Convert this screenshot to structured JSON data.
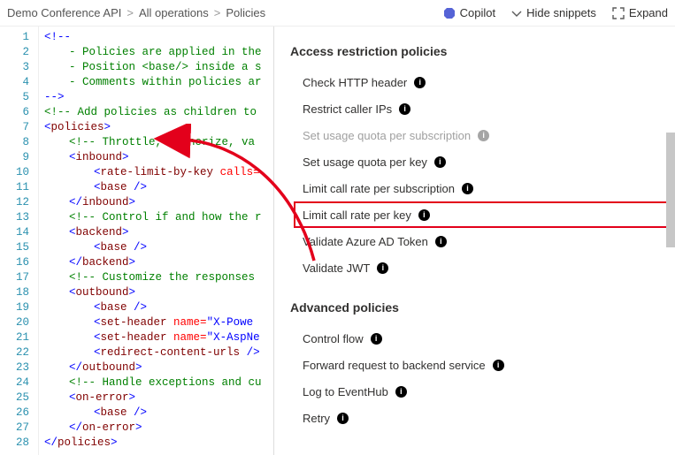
{
  "breadcrumb": {
    "api": "Demo Conference API",
    "scope": "All operations",
    "section": "Policies"
  },
  "toolbar": {
    "copilot": "Copilot",
    "hide_snippets": "Hide snippets",
    "expand": "Expand"
  },
  "code_lines": [
    {
      "n": 1,
      "cls": "",
      "html": "<span class='c-punc'>&lt;!--</span>"
    },
    {
      "n": 2,
      "cls": "ind1",
      "html": "<span class='c-cmt'>- Policies are applied in the</span>"
    },
    {
      "n": 3,
      "cls": "ind1",
      "html": "<span class='c-cmt'>- Position &lt;base/&gt; inside a s</span>"
    },
    {
      "n": 4,
      "cls": "ind1",
      "html": "<span class='c-cmt'>- Comments within policies ar</span>"
    },
    {
      "n": 5,
      "cls": "",
      "html": "<span class='c-punc'>--&gt;</span>"
    },
    {
      "n": 6,
      "cls": "",
      "html": "<span class='c-cmt'>&lt;!-- Add policies as children to</span>"
    },
    {
      "n": 7,
      "cls": "",
      "html": "<span class='c-punc'>&lt;</span><span class='c-tag'>policies</span><span class='c-punc'>&gt;</span>"
    },
    {
      "n": 8,
      "cls": "ind1",
      "html": "<span class='c-cmt'>&lt;!-- Throttle, authorize, va</span>"
    },
    {
      "n": 9,
      "cls": "ind1",
      "html": "<span class='c-punc'>&lt;</span><span class='c-tag'>inbound</span><span class='c-punc'>&gt;</span>"
    },
    {
      "n": 10,
      "cls": "ind2",
      "html": "<span class='c-punc'>&lt;</span><span class='c-tag'>rate-limit-by-key</span> <span class='c-attr'>calls=</span>"
    },
    {
      "n": 11,
      "cls": "ind2",
      "html": "<span class='c-punc'>&lt;</span><span class='c-tag'>base</span> <span class='c-punc'>/&gt;</span>"
    },
    {
      "n": 12,
      "cls": "ind1",
      "html": "<span class='c-punc'>&lt;/</span><span class='c-tag'>inbound</span><span class='c-punc'>&gt;</span>"
    },
    {
      "n": 13,
      "cls": "ind1",
      "html": "<span class='c-cmt'>&lt;!-- Control if and how the r</span>"
    },
    {
      "n": 14,
      "cls": "ind1",
      "html": "<span class='c-punc'>&lt;</span><span class='c-tag'>backend</span><span class='c-punc'>&gt;</span>"
    },
    {
      "n": 15,
      "cls": "ind2",
      "html": "<span class='c-punc'>&lt;</span><span class='c-tag'>base</span> <span class='c-punc'>/&gt;</span>"
    },
    {
      "n": 16,
      "cls": "ind1",
      "html": "<span class='c-punc'>&lt;/</span><span class='c-tag'>backend</span><span class='c-punc'>&gt;</span>"
    },
    {
      "n": 17,
      "cls": "ind1",
      "html": "<span class='c-cmt'>&lt;!-- Customize the responses</span>"
    },
    {
      "n": 18,
      "cls": "ind1",
      "html": "<span class='c-punc'>&lt;</span><span class='c-tag'>outbound</span><span class='c-punc'>&gt;</span>"
    },
    {
      "n": 19,
      "cls": "ind2",
      "html": "<span class='c-punc'>&lt;</span><span class='c-tag'>base</span> <span class='c-punc'>/&gt;</span>"
    },
    {
      "n": 20,
      "cls": "ind2",
      "html": "<span class='c-punc'>&lt;</span><span class='c-tag'>set-header</span> <span class='c-attr'>name=</span><span class='c-str'>\"X-Powe</span>"
    },
    {
      "n": 21,
      "cls": "ind2",
      "html": "<span class='c-punc'>&lt;</span><span class='c-tag'>set-header</span> <span class='c-attr'>name=</span><span class='c-str'>\"X-AspNe</span>"
    },
    {
      "n": 22,
      "cls": "ind2",
      "html": "<span class='c-punc'>&lt;</span><span class='c-tag'>redirect-content-urls</span> <span class='c-punc'>/&gt;</span>"
    },
    {
      "n": 23,
      "cls": "ind1",
      "html": "<span class='c-punc'>&lt;/</span><span class='c-tag'>outbound</span><span class='c-punc'>&gt;</span>"
    },
    {
      "n": 24,
      "cls": "ind1",
      "html": "<span class='c-cmt'>&lt;!-- Handle exceptions and cu</span>"
    },
    {
      "n": 25,
      "cls": "ind1",
      "html": "<span class='c-punc'>&lt;</span><span class='c-tag'>on-error</span><span class='c-punc'>&gt;</span>"
    },
    {
      "n": 26,
      "cls": "ind2",
      "html": "<span class='c-punc'>&lt;</span><span class='c-tag'>base</span> <span class='c-punc'>/&gt;</span>"
    },
    {
      "n": 27,
      "cls": "ind1",
      "html": "<span class='c-punc'>&lt;/</span><span class='c-tag'>on-error</span><span class='c-punc'>&gt;</span>"
    },
    {
      "n": 28,
      "cls": "",
      "html": "<span class='c-punc'>&lt;/</span><span class='c-tag'>policies</span><span class='c-punc'>&gt;</span>"
    }
  ],
  "panel": {
    "group1_heading": "Access restriction policies",
    "group1_items": [
      {
        "label": "Check HTTP header",
        "disabled": false,
        "highlighted": false
      },
      {
        "label": "Restrict caller IPs",
        "disabled": false,
        "highlighted": false
      },
      {
        "label": "Set usage quota per subscription",
        "disabled": true,
        "highlighted": false
      },
      {
        "label": "Set usage quota per key",
        "disabled": false,
        "highlighted": false
      },
      {
        "label": "Limit call rate per subscription",
        "disabled": false,
        "highlighted": false
      },
      {
        "label": "Limit call rate per key",
        "disabled": false,
        "highlighted": true
      },
      {
        "label": "Validate Azure AD Token",
        "disabled": false,
        "highlighted": false
      },
      {
        "label": "Validate JWT",
        "disabled": false,
        "highlighted": false
      }
    ],
    "group2_heading": "Advanced policies",
    "group2_items": [
      {
        "label": "Control flow",
        "disabled": false,
        "highlighted": false
      },
      {
        "label": "Forward request to backend service",
        "disabled": false,
        "highlighted": false
      },
      {
        "label": "Log to EventHub",
        "disabled": false,
        "highlighted": false
      },
      {
        "label": "Retry",
        "disabled": false,
        "highlighted": false
      }
    ]
  }
}
